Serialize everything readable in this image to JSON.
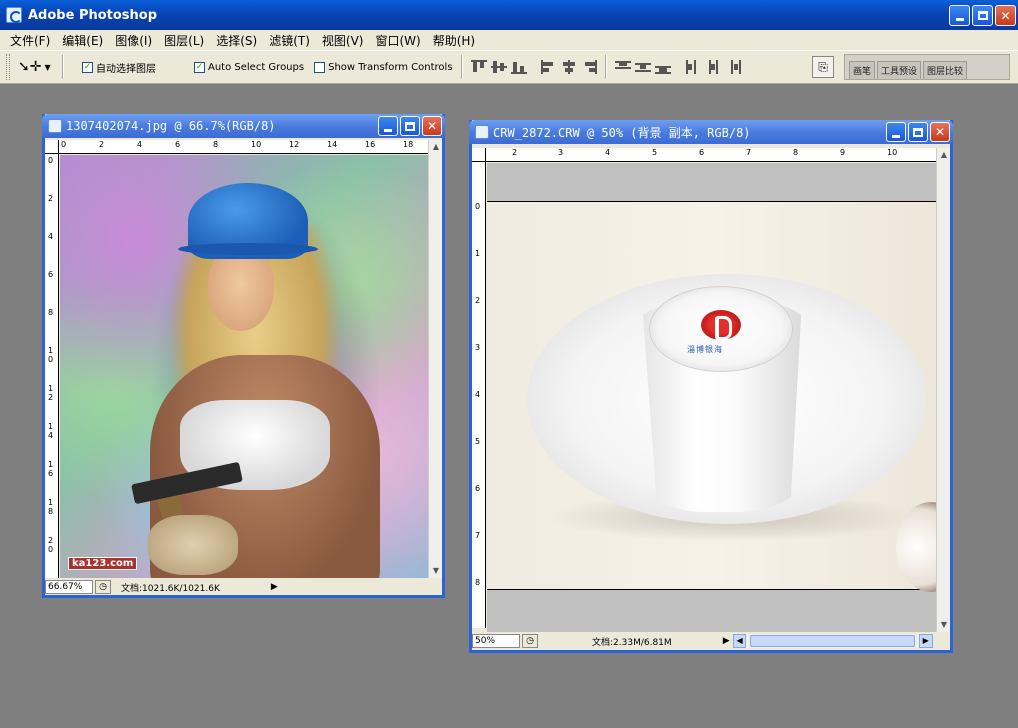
{
  "app": {
    "title": "Adobe Photoshop"
  },
  "menu": {
    "items": [
      "文件(F)",
      "编辑(E)",
      "图像(I)",
      "图层(L)",
      "选择(S)",
      "滤镜(T)",
      "视图(V)",
      "窗口(W)",
      "帮助(H)"
    ]
  },
  "options": {
    "auto_select_layer": {
      "label": "自动选择图层",
      "checked": true
    },
    "auto_select_groups": {
      "label": "Auto Select Groups",
      "checked": true
    },
    "show_transform": {
      "label": "Show Transform Controls",
      "checked": false
    },
    "palette_tabs": [
      "画笔",
      "工具预设",
      "图层比较"
    ]
  },
  "doc1": {
    "title": "1307402074.jpg @ 66.7%(RGB/8)",
    "zoom": "66.67%",
    "info": "文档:1021.6K/1021.6K",
    "watermark": "ka123.com",
    "ruler_h": [
      "0",
      "2",
      "4",
      "6",
      "8",
      "10",
      "12",
      "14",
      "16",
      "18"
    ],
    "ruler_v": [
      "0",
      "2",
      "4",
      "6",
      "8",
      "1 0",
      "1 2",
      "1 4",
      "1 6",
      "1 8",
      "2 0"
    ]
  },
  "doc2": {
    "title": "CRW_2872.CRW @ 50% (背景 副本, RGB/8)",
    "zoom": "50%",
    "info": "文档:2.33M/6.81M",
    "logo_text": "淄博银海",
    "ruler_h": [
      "2",
      "3",
      "4",
      "5",
      "6",
      "7",
      "8",
      "9",
      "10"
    ],
    "ruler_v": [
      "0",
      "1",
      "2",
      "3",
      "4",
      "5",
      "6",
      "7",
      "8"
    ]
  },
  "colors": {
    "title_bar": "#0842b0",
    "doc_title": "#4a7ce0",
    "workspace": "#7f7f7f",
    "chrome": "#ece9d8"
  }
}
